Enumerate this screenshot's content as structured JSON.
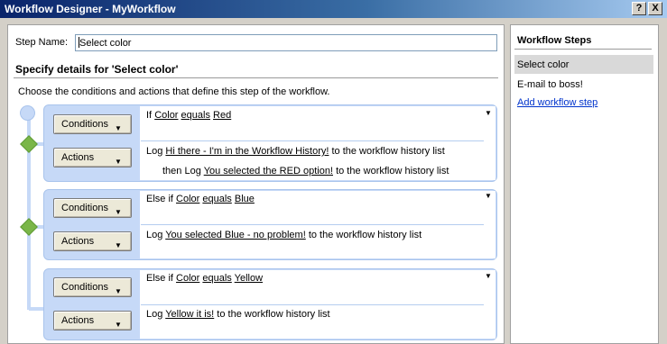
{
  "window": {
    "title": "Workflow Designer - MyWorkflow",
    "help_label": "?",
    "close_label": "X"
  },
  "form": {
    "step_name_label": "Step Name:",
    "step_name_value": "Select color",
    "details_heading": "Specify details for 'Select color'",
    "instructions": "Choose the conditions and actions that define this step of the workflow."
  },
  "branches": [
    {
      "conditions_label": "Conditions",
      "actions_label": "Actions",
      "condition": {
        "prefix": "If",
        "field": "Color",
        "operator": "equals",
        "value": "Red"
      },
      "actions": [
        {
          "prefix": "Log",
          "message": "Hi there - I'm in the Workflow History!",
          "suffix": "to the workflow history list"
        },
        {
          "prefix": "then Log",
          "message": "You selected the RED option!",
          "suffix": "to the workflow history list"
        }
      ]
    },
    {
      "conditions_label": "Conditions",
      "actions_label": "Actions",
      "condition": {
        "prefix": "Else if",
        "field": "Color",
        "operator": "equals",
        "value": "Blue"
      },
      "actions": [
        {
          "prefix": "Log",
          "message": "You selected Blue - no problem!",
          "suffix": "to the workflow history list"
        }
      ]
    },
    {
      "conditions_label": "Conditions",
      "actions_label": "Actions",
      "condition": {
        "prefix": "Else if",
        "field": "Color",
        "operator": "equals",
        "value": "Yellow"
      },
      "actions": [
        {
          "prefix": "Log",
          "message": "Yellow it is!",
          "suffix": "to the workflow history list"
        }
      ]
    }
  ],
  "sidebar": {
    "title": "Workflow Steps",
    "steps": [
      {
        "label": "Select color",
        "selected": true
      },
      {
        "label": "E-mail to boss!",
        "selected": false
      }
    ],
    "add_link": "Add workflow step"
  },
  "colors": {
    "branch_fill": "#c6d9f7",
    "diamond": "#7ab648",
    "link": "#0033cc",
    "title_bar": "#0a246a"
  },
  "icons": {
    "dropdown": "triangle-down-icon",
    "branch_marker": "diamond-icon",
    "start_node": "circle-node-icon"
  }
}
